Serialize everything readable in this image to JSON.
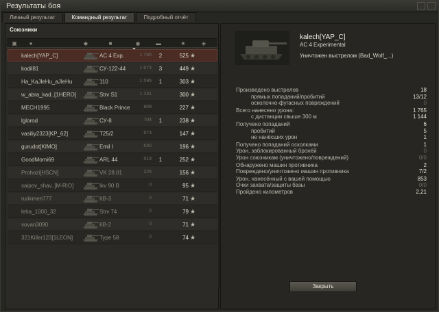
{
  "window": {
    "title": "Результаты боя"
  },
  "tabs": [
    {
      "label": "Личный результат"
    },
    {
      "label": "Командный результат"
    },
    {
      "label": "Подробный отчёт"
    }
  ],
  "left": {
    "title": "Союзники",
    "rows": [
      {
        "name": "kalech[YAP_C]",
        "tank": "AC 4 Exp.",
        "damage": "1 765",
        "frags": "2",
        "xp": "525"
      },
      {
        "name": "kodil81",
        "tank": "СУ-122-44",
        "damage": "1 673",
        "frags": "3",
        "xp": "449"
      },
      {
        "name": "Ha_KaJleHu_aJleHu",
        "tank": "110",
        "damage": "1 595",
        "frags": "1",
        "xp": "303"
      },
      {
        "name": "w_abra_kad..[1HERO]",
        "tank": "Strv S1",
        "damage": "1 231",
        "frags": "",
        "xp": "300"
      },
      {
        "name": "MECH1995",
        "tank": "Black Prince",
        "damage": "809",
        "frags": "",
        "xp": "227"
      },
      {
        "name": "lglorod",
        "tank": "СУ-8",
        "damage": "704",
        "frags": "1",
        "xp": "238"
      },
      {
        "name": "vasiliy2323[KP_62]",
        "tank": "T25/2",
        "damage": "673",
        "frags": "",
        "xp": "147"
      },
      {
        "name": "gurudot[KIMO]",
        "tank": "Emil I",
        "damage": "630",
        "frags": "",
        "xp": "196"
      },
      {
        "name": "GoodMomi69",
        "tank": "ARL 44",
        "damage": "519",
        "frags": "1",
        "xp": "252"
      },
      {
        "name": "Prohozi[HSCN]",
        "tank": "VK 28.01",
        "damage": "225",
        "frags": "",
        "xp": "156"
      },
      {
        "name": "saipov_shav..[M-RIO]",
        "tank": "Ikv 90 B",
        "damage": "0",
        "frags": "",
        "xp": "95"
      },
      {
        "name": "rurikmen777",
        "tank": "КВ-3",
        "damage": "0",
        "frags": "",
        "xp": "71"
      },
      {
        "name": "leha_1000_32",
        "tank": "Strv 74",
        "damage": "0",
        "frags": "",
        "xp": "79"
      },
      {
        "name": "vovan3090",
        "tank": "КВ-2",
        "damage": "0",
        "frags": "",
        "xp": "71"
      },
      {
        "name": "321Killer123[1LEON]",
        "tank": "Type 58",
        "damage": "0",
        "frags": "",
        "xp": "74"
      }
    ]
  },
  "right": {
    "player_name": "kalech[YAP_C]",
    "player_tank": "AC 4 Experimental",
    "killed_by": "Уничтожен выстрелом (Bad_Wolf_...)",
    "stats": [
      {
        "label": "Произведено выстрелов",
        "value": "18",
        "sub": false,
        "dim": false
      },
      {
        "label": "прямых попаданий/пробитий",
        "value": "13/12",
        "sub": true,
        "dim": false
      },
      {
        "label": "осколочно-фугасных повреждений",
        "value": "0",
        "sub": true,
        "dim": true
      },
      {
        "label": "Всего нанесено урона:",
        "value": "1 765",
        "sub": false,
        "dim": false
      },
      {
        "label": "с дистанции свыше 300 м",
        "value": "1 144",
        "sub": true,
        "dim": false
      },
      {
        "label": "Получено попаданий",
        "value": "6",
        "sub": false,
        "dim": false
      },
      {
        "label": "пробитий",
        "value": "5",
        "sub": true,
        "dim": false
      },
      {
        "label": "не нанёсших урон",
        "value": "1",
        "sub": true,
        "dim": false
      },
      {
        "label": "Получено попаданий осколками",
        "value": "1",
        "sub": false,
        "dim": false
      },
      {
        "label": "Урон, заблокированный бронёй",
        "value": "0",
        "sub": false,
        "dim": true
      },
      {
        "label": "Урон союзникам (уничтожено/повреждений)",
        "value": "0/0",
        "sub": false,
        "dim": true
      },
      {
        "label": "Обнаружено машин противника",
        "value": "2",
        "sub": false,
        "dim": false
      },
      {
        "label": "Повреждено/уничтожено машин противника",
        "value": "7/2",
        "sub": false,
        "dim": false
      },
      {
        "label": "Урон, нанесённый с вашей помощью",
        "value": "853",
        "sub": false,
        "dim": false
      },
      {
        "label": "Очки захвата/защиты базы",
        "value": "0/0",
        "sub": false,
        "dim": true
      },
      {
        "label": "Пройдено километров",
        "value": "2,21",
        "sub": false,
        "dim": false
      }
    ],
    "close_label": "Закрыть"
  }
}
